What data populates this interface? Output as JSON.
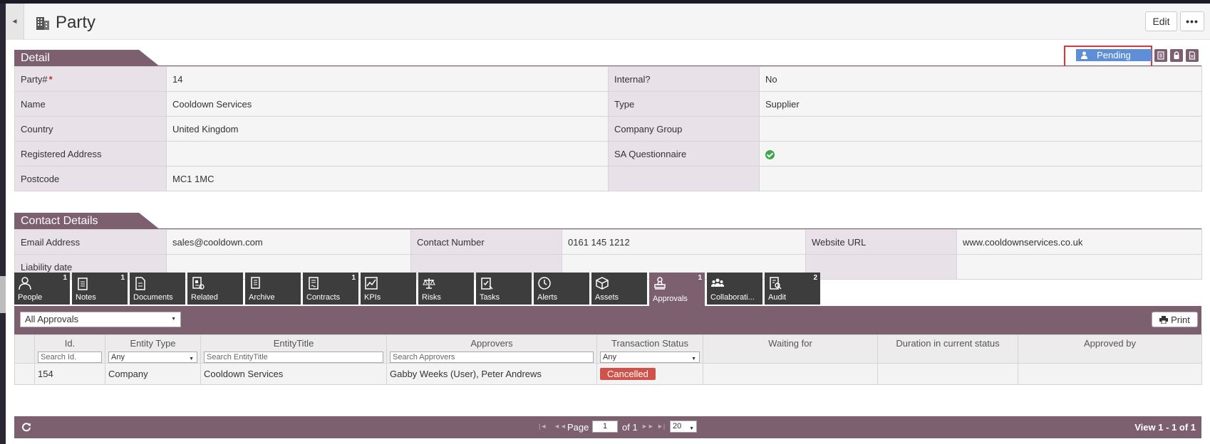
{
  "header": {
    "title": "Party",
    "edit_label": "Edit",
    "more_label": "•••"
  },
  "status": {
    "label": "Pending"
  },
  "detail": {
    "section_title": "Detail",
    "rows": [
      {
        "l1": "Party#",
        "v1": "14",
        "l2": "Internal?",
        "v2": "No"
      },
      {
        "l1": "Name",
        "v1": "Cooldown Services",
        "l2": "Type",
        "v2": "Supplier"
      },
      {
        "l1": "Country",
        "v1": "United Kingdom",
        "l2": "Company Group",
        "v2": ""
      },
      {
        "l1": "Registered Address",
        "v1": "",
        "l2": "SA Questionnaire",
        "v2": ""
      },
      {
        "l1": "Postcode",
        "v1": "MC1 1MC",
        "l2": "",
        "v2": ""
      }
    ],
    "required_mark": "*"
  },
  "contact": {
    "section_title": "Contact Details",
    "rows": [
      {
        "l1": "Email Address",
        "v1": "sales@cooldown.com",
        "l2": "Contact Number",
        "v2": "0161 145 1212",
        "l3": "Website URL",
        "v3": "www.cooldownservices.co.uk"
      },
      {
        "l1": "Liability date",
        "v1": "",
        "l2": "",
        "v2": "",
        "l3": "",
        "v3": ""
      }
    ]
  },
  "tabs": [
    {
      "label": "People",
      "count": "1",
      "icon": "person-icon"
    },
    {
      "label": "Notes",
      "count": "1",
      "icon": "notepad-icon"
    },
    {
      "label": "Documents",
      "count": "",
      "icon": "document-icon"
    },
    {
      "label": "Related",
      "count": "",
      "icon": "related-icon"
    },
    {
      "label": "Archive",
      "count": "",
      "icon": "archive-icon"
    },
    {
      "label": "Contracts",
      "count": "1",
      "icon": "contract-icon"
    },
    {
      "label": "KPIs",
      "count": "",
      "icon": "chart-icon"
    },
    {
      "label": "Risks",
      "count": "",
      "icon": "scales-icon"
    },
    {
      "label": "Tasks",
      "count": "",
      "icon": "task-icon"
    },
    {
      "label": "Alerts",
      "count": "",
      "icon": "clock-icon"
    },
    {
      "label": "Assets",
      "count": "",
      "icon": "box-icon"
    },
    {
      "label": "Approvals",
      "count": "1",
      "icon": "stamp-icon"
    },
    {
      "label": "Collaborati...",
      "count": "",
      "icon": "group-icon"
    },
    {
      "label": "Audit",
      "count": "2",
      "icon": "audit-icon"
    }
  ],
  "approvals": {
    "filter_value": "All Approvals",
    "print_label": "Print",
    "columns": [
      "Id.",
      "Entity Type",
      "EntityTitle",
      "Approvers",
      "Transaction Status",
      "Waiting for",
      "Duration in current status",
      "Approved by"
    ],
    "filters": {
      "id_placeholder": "Search  Id.",
      "entity_type": "Any",
      "title_placeholder": "Search EntityTitle",
      "approvers_placeholder": "Search Approvers",
      "status": "Any"
    },
    "rows": [
      {
        "id": "154",
        "entity_type": "Company",
        "title": "Cooldown Services",
        "approvers": "Gabby Weeks (User), Peter Andrews",
        "status": "Cancelled",
        "waiting": "",
        "duration": "",
        "approved_by": ""
      }
    ],
    "pager": {
      "page_label": "Page",
      "page": "1",
      "of_label": "of 1",
      "page_size": "20",
      "view_text": "View 1 - 1 of 1"
    }
  },
  "colors": {
    "accent": "#7c6070",
    "status_blue": "#5e8ed6",
    "cancelled_red": "#d0534b",
    "highlight_red": "#e0343a"
  }
}
